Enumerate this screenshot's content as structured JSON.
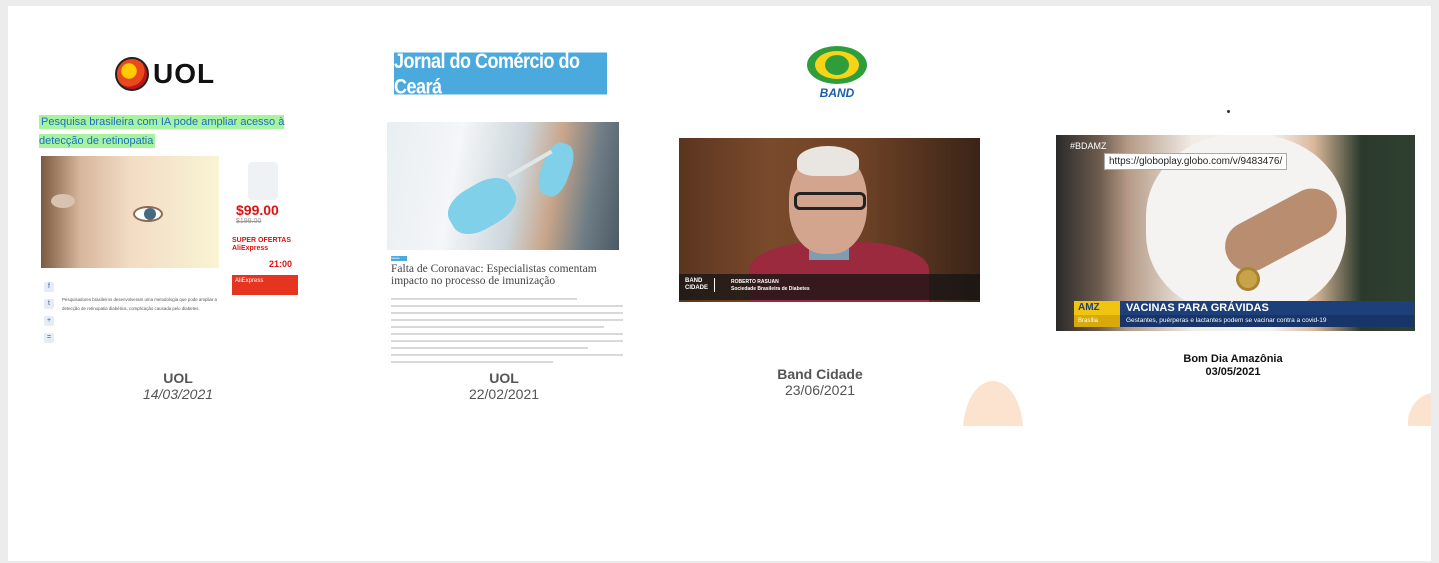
{
  "colors": {
    "background": "#ffffff",
    "peach_decoration": "#fbe3cf",
    "uol_headline_highlight": "#a7f3a0",
    "jornal_blue": "#4aa9dd",
    "band_green": "#2f9e3a",
    "band_yellow": "#f7d417"
  },
  "uol": {
    "logo_text": "UOL",
    "headline": "Pesquisa brasileira com IA pode ampliar acesso à detecção de retinopatia",
    "ad": {
      "price": "$99.00",
      "old_price": "$199.00",
      "promo": "SUPER OFERTAS AliExpress",
      "time": "21:00",
      "button": "AliExpress"
    },
    "share_icons": [
      "f",
      "t",
      "+",
      "="
    ],
    "body": "Pesquisadores brasileiros desenvolveram uma metodologia que pode ampliar a detecção de retinopatia diabética, complicação causada pelo diabetes.",
    "caption": {
      "source": "UOL",
      "date": "14/03/2021"
    }
  },
  "jornal": {
    "logo_text": "Jornal do Comércio do Ceará",
    "tag": "Saúde",
    "title": "Falta de Coronavac: Especialistas comentam impacto no processo de imunização",
    "caption": {
      "source": "UOL",
      "date": "22/02/2021"
    }
  },
  "band": {
    "logo_text": "BAND",
    "lower_tag_line1": "BAND",
    "lower_tag_line2": "CIDADE",
    "lower_name": "ROBERTO RASUAN",
    "lower_role": "Sociedade Brasileira de Diabetes",
    "caption": {
      "source": "Band Cidade",
      "date": "23/06/2021"
    }
  },
  "globo": {
    "hashtag": "#BDAMZ",
    "url": "https://globoplay.globo.com/v/9483476/",
    "lower_logo": "AMZ",
    "lower_title": "VACINAS PARA GRÁVIDAS",
    "lower_place": "Brasília",
    "lower_sub": "Gestantes, puérperas e lactantes podem se vacinar contra a covid-19",
    "caption": {
      "source": "Bom Dia Amazônia",
      "date": "03/05/2021"
    }
  }
}
